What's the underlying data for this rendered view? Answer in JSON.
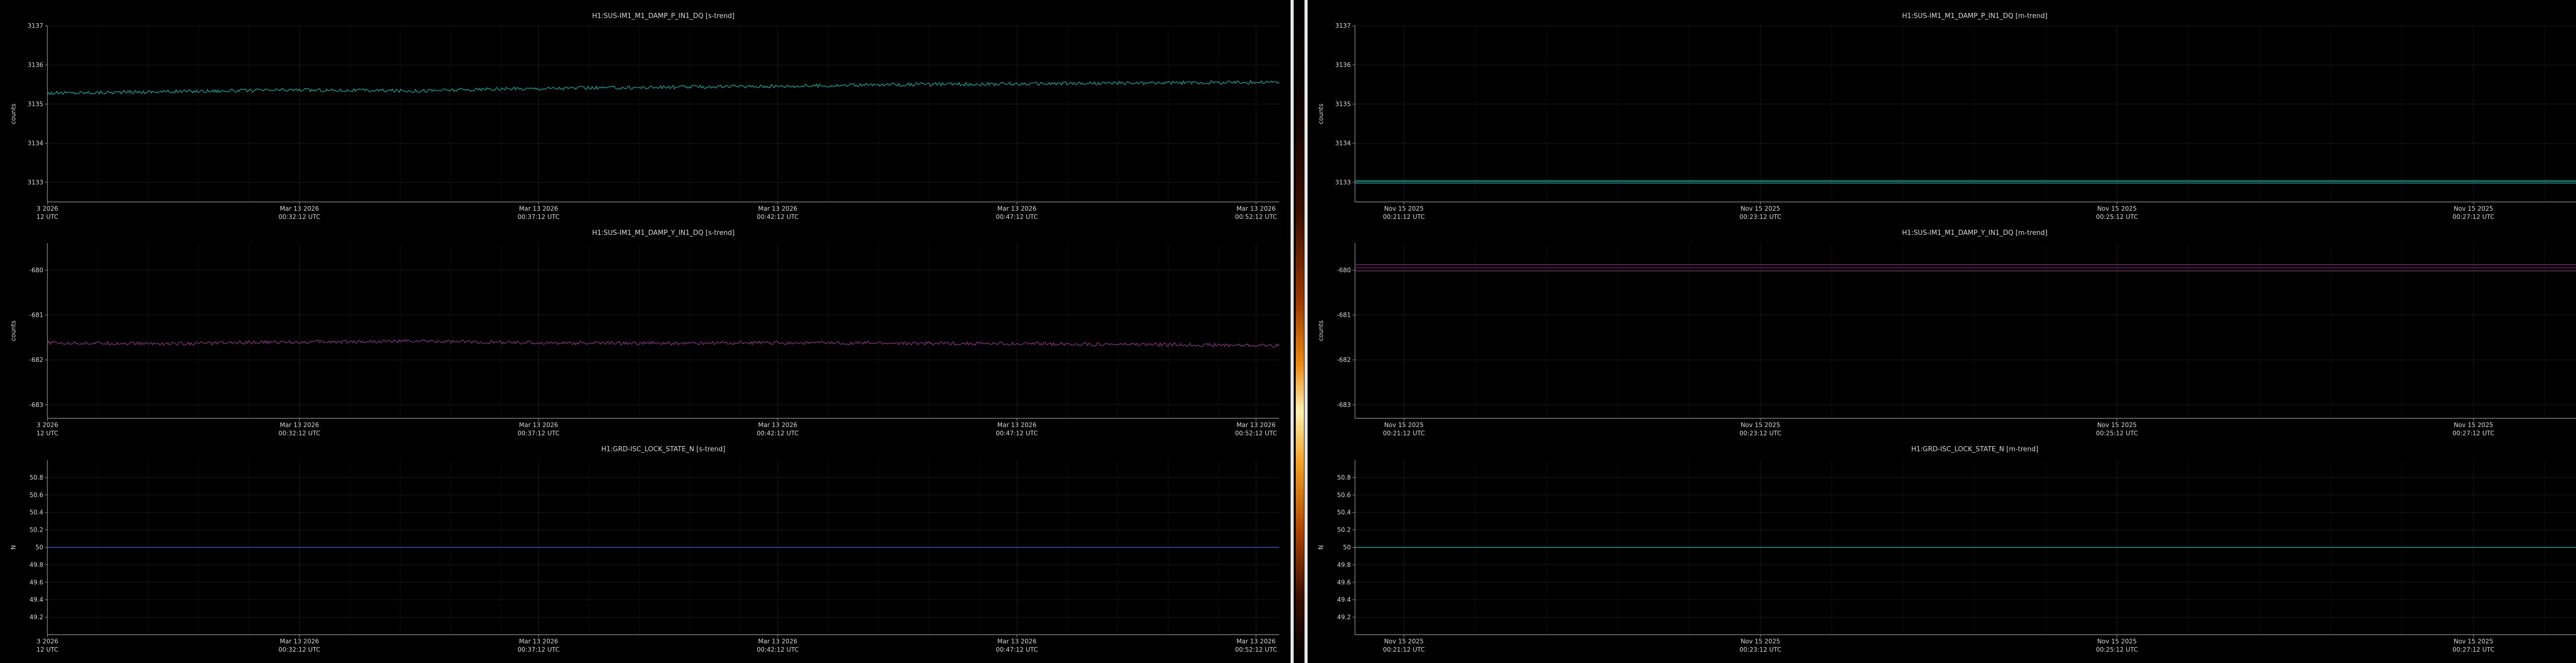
{
  "colors": {
    "teal": "#2aa89a",
    "purple": "#8a3a86",
    "blue": "#3f5fb8",
    "axis": "#9a9a9a",
    "grid": "#1c1c1c",
    "text": "#d8d8d8"
  },
  "panes": [
    {
      "name": "left",
      "charts": [
        {
          "type": "line",
          "title": "H1:SUS-IM1_M1_DAMP_P_IN1_DQ [s-trend]",
          "ylabel": "counts",
          "ylim": [
            3132.5,
            3137
          ],
          "yticks": [
            3133,
            3134,
            3135,
            3136,
            3137
          ],
          "xticks": [
            {
              "l1": "3 2026",
              "l2": "12 UTC"
            },
            {
              "l1": "Mar 13 2026",
              "l2": "00:32:12 UTC"
            },
            {
              "l1": "Mar 13 2026",
              "l2": "00:37:12 UTC"
            },
            {
              "l1": "Mar 13 2026",
              "l2": "00:42:12 UTC"
            },
            {
              "l1": "Mar 13 2026",
              "l2": "00:47:12 UTC"
            },
            {
              "l1": "Mar 13 2026",
              "l2": "00:52:12 UTC"
            }
          ],
          "series": [
            {
              "color": "teal",
              "band": [
                [
                  0,
                  3135.28
                ],
                [
                  0.1,
                  3135.32
                ],
                [
                  0.2,
                  3135.36
                ],
                [
                  0.3,
                  3135.34
                ],
                [
                  0.4,
                  3135.4
                ],
                [
                  0.5,
                  3135.43
                ],
                [
                  0.6,
                  3135.46
                ],
                [
                  0.7,
                  3135.5
                ],
                [
                  0.8,
                  3135.52
                ],
                [
                  0.9,
                  3135.54
                ],
                [
                  1,
                  3135.56
                ]
              ]
            }
          ]
        },
        {
          "type": "line",
          "title": "H1:SUS-IM1_M1_DAMP_Y_IN1_DQ [s-trend]",
          "ylabel": "counts",
          "ylim": [
            -683.3,
            -679.4
          ],
          "yticks": [
            -680,
            -681,
            -682,
            -683
          ],
          "xticks": [
            {
              "l1": "3 2026",
              "l2": "12 UTC"
            },
            {
              "l1": "Mar 13 2026",
              "l2": "00:32:12 UTC"
            },
            {
              "l1": "Mar 13 2026",
              "l2": "00:37:12 UTC"
            },
            {
              "l1": "Mar 13 2026",
              "l2": "00:42:12 UTC"
            },
            {
              "l1": "Mar 13 2026",
              "l2": "00:47:12 UTC"
            },
            {
              "l1": "Mar 13 2026",
              "l2": "00:52:12 UTC"
            }
          ],
          "series": [
            {
              "color": "purple",
              "band": [
                [
                  0,
                  -681.62
                ],
                [
                  0.1,
                  -681.64
                ],
                [
                  0.2,
                  -681.6
                ],
                [
                  0.3,
                  -681.58
                ],
                [
                  0.4,
                  -681.62
                ],
                [
                  0.5,
                  -681.63
                ],
                [
                  0.6,
                  -681.62
                ],
                [
                  0.7,
                  -681.63
                ],
                [
                  0.8,
                  -681.64
                ],
                [
                  0.9,
                  -681.66
                ],
                [
                  1,
                  -681.68
                ]
              ]
            }
          ]
        },
        {
          "type": "line",
          "title": "H1:GRD-ISC_LOCK_STATE_N [s-trend]",
          "ylabel": "N",
          "ylim": [
            49.0,
            51.0
          ],
          "yticks": [
            50.8,
            50.6,
            50.4,
            50.2,
            50,
            49.8,
            49.6,
            49.4,
            49.2
          ],
          "xticks": [
            {
              "l1": "3 2026",
              "l2": "12 UTC"
            },
            {
              "l1": "Mar 13 2026",
              "l2": "00:32:12 UTC"
            },
            {
              "l1": "Mar 13 2026",
              "l2": "00:37:12 UTC"
            },
            {
              "l1": "Mar 13 2026",
              "l2": "00:42:12 UTC"
            },
            {
              "l1": "Mar 13 2026",
              "l2": "00:47:12 UTC"
            },
            {
              "l1": "Mar 13 2026",
              "l2": "00:52:12 UTC"
            }
          ],
          "series": [
            {
              "color": "blue",
              "flat": 50
            }
          ]
        }
      ]
    },
    {
      "name": "right",
      "charts": [
        {
          "type": "line",
          "title": "H1:SUS-IM1_M1_DAMP_P_IN1_DQ [m-trend]",
          "ylabel": "counts",
          "ylim": [
            3132.5,
            3137
          ],
          "yticks": [
            3133,
            3134,
            3135,
            3136,
            3137
          ],
          "xticks": [
            {
              "l1": "Nov 15 2025",
              "l2": "00:21:12 UTC"
            },
            {
              "l1": "Nov 15 2025",
              "l2": "00:23:12 UTC"
            },
            {
              "l1": "Nov 15 2025",
              "l2": "00:25:12 UTC"
            },
            {
              "l1": "Nov 15 2025",
              "l2": "00:27:12 UTC"
            }
          ],
          "series": [
            {
              "color": "teal",
              "lines": [
                3133.05,
                3133.02,
                3132.98
              ]
            }
          ]
        },
        {
          "type": "line",
          "title": "H1:SUS-IM1_M1_DAMP_Y_IN1_DQ [m-trend]",
          "ylabel": "counts",
          "ylim": [
            -683.3,
            -679.4
          ],
          "yticks": [
            -680,
            -681,
            -682,
            -683
          ],
          "xticks": [
            {
              "l1": "Nov 15 2025",
              "l2": "00:21:12 UTC"
            },
            {
              "l1": "Nov 15 2025",
              "l2": "00:23:12 UTC"
            },
            {
              "l1": "Nov 15 2025",
              "l2": "00:25:12 UTC"
            },
            {
              "l1": "Nov 15 2025",
              "l2": "00:27:12 UTC"
            }
          ],
          "series": [
            {
              "color": "purple",
              "lines": [
                -679.88,
                -679.95,
                -680.02
              ]
            }
          ]
        },
        {
          "type": "line",
          "title": "H1:GRD-ISC_LOCK_STATE_N [m-trend]",
          "ylabel": "N",
          "ylim": [
            49.0,
            51.0
          ],
          "yticks": [
            50.8,
            50.6,
            50.4,
            50.2,
            50,
            49.8,
            49.6,
            49.4,
            49.2
          ],
          "xticks": [
            {
              "l1": "Nov 15 2025",
              "l2": "00:21:12 UTC"
            },
            {
              "l1": "Nov 15 2025",
              "l2": "00:23:12 UTC"
            },
            {
              "l1": "Nov 15 2025",
              "l2": "00:25:12 UTC"
            },
            {
              "l1": "Nov 15 2025",
              "l2": "00:27:12 UTC"
            }
          ],
          "series": [
            {
              "color": "teal",
              "flat": 50
            }
          ]
        }
      ]
    }
  ]
}
